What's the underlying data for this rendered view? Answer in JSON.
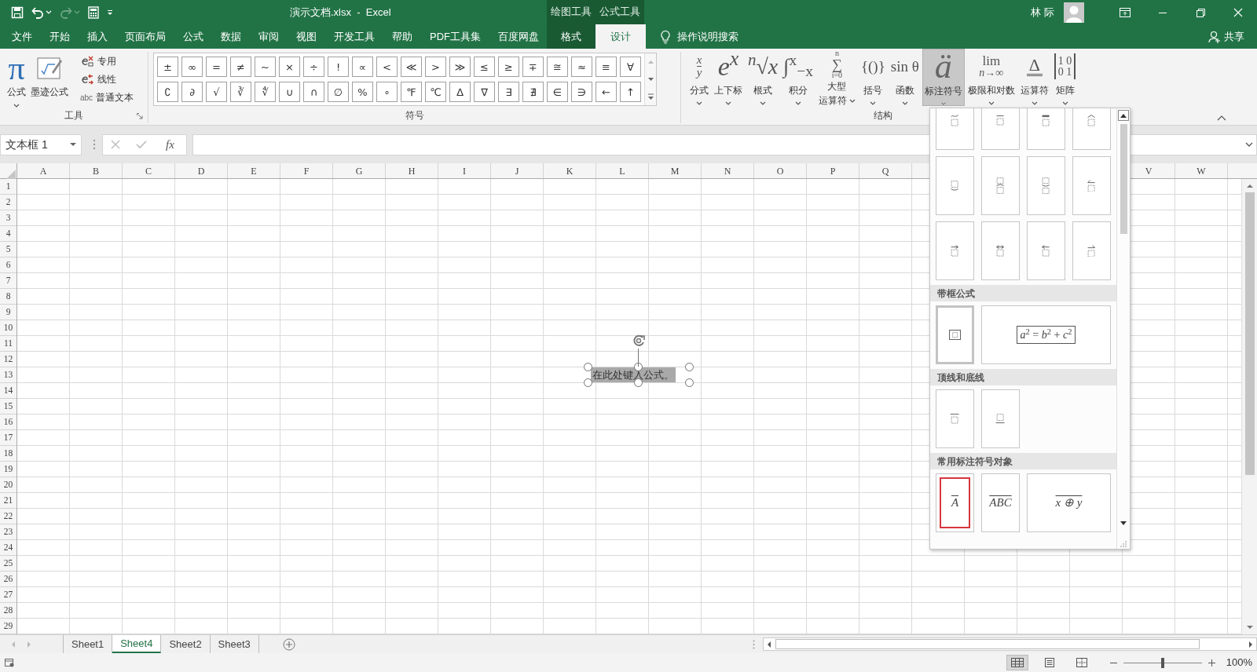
{
  "title_bar": {
    "quick_access": [
      {
        "kind": "save",
        "disabled": false
      },
      {
        "kind": "undo",
        "disabled": false
      },
      {
        "kind": "redo",
        "disabled": true
      },
      {
        "kind": "calculator",
        "disabled": false
      },
      {
        "kind": "customize",
        "disabled": false
      }
    ],
    "title": "演示文档.xlsx  -  Excel",
    "context_headers": [
      "绘图工具",
      "公式工具"
    ],
    "user": "林 际"
  },
  "ribbon_tabs": [
    {
      "label": "文件",
      "selected": false,
      "contextual": false
    },
    {
      "label": "开始",
      "selected": false,
      "contextual": false
    },
    {
      "label": "插入",
      "selected": false,
      "contextual": false
    },
    {
      "label": "页面布局",
      "selected": false,
      "contextual": false
    },
    {
      "label": "公式",
      "selected": false,
      "contextual": false
    },
    {
      "label": "数据",
      "selected": false,
      "contextual": false
    },
    {
      "label": "审阅",
      "selected": false,
      "contextual": false
    },
    {
      "label": "视图",
      "selected": false,
      "contextual": false
    },
    {
      "label": "开发工具",
      "selected": false,
      "contextual": false
    },
    {
      "label": "帮助",
      "selected": false,
      "contextual": false
    },
    {
      "label": "PDF工具集",
      "selected": false,
      "contextual": false
    },
    {
      "label": "百度网盘",
      "selected": false,
      "contextual": false
    },
    {
      "label": "格式",
      "selected": false,
      "contextual": true
    },
    {
      "label": "设计",
      "selected": true,
      "contextual": true
    }
  ],
  "tell_me": "操作说明搜索",
  "share": "共享",
  "tools_group": {
    "label": "工具",
    "big_buttons": [
      {
        "kind": "pi",
        "glyph": "π",
        "label": "公式",
        "dropdown": true
      },
      {
        "kind": "ink",
        "label": "墨迹公式",
        "dropdown": false
      }
    ],
    "small_buttons": [
      {
        "kind": "professional",
        "label": "专用"
      },
      {
        "kind": "linear",
        "label": "线性"
      },
      {
        "kind": "normal-text",
        "prefix": "abc",
        "label": "普通文本"
      }
    ]
  },
  "symbols_group": {
    "label": "符号",
    "rows": [
      [
        "±",
        "∞",
        "=",
        "≠",
        "~",
        "×",
        "÷",
        "!",
        "∝",
        "<",
        "≪",
        ">",
        "≫",
        "≤",
        "≥",
        "∓",
        "≅",
        "≈",
        "≡",
        "∀"
      ],
      [
        "∁",
        "∂",
        "√",
        "∛",
        "∜",
        "∪",
        "∩",
        "∅",
        "%",
        "∘",
        "℉",
        "℃",
        "∆",
        "∇",
        "∃",
        "∄",
        "∈",
        "∋",
        "←",
        "↑"
      ]
    ]
  },
  "structures_group": {
    "label": "结构",
    "items": [
      {
        "kind": "fraction",
        "glyph_lines": [
          "x",
          "y"
        ],
        "label": "分式",
        "selected": false
      },
      {
        "kind": "script",
        "glyph_lines": [
          "e$^{x}$"
        ],
        "label": "上下标",
        "selected": false
      },
      {
        "kind": "radical",
        "glyph_lines": [
          "$^{n}$√x"
        ],
        "label": "根式",
        "selected": false
      },
      {
        "kind": "integral",
        "glyph_lines": [
          "∫$^{x}$$_{−x}$"
        ],
        "label": "积分",
        "selected": false
      },
      {
        "kind": "sum",
        "glyph_lines": [
          "n",
          "∑",
          "i=0"
        ],
        "label": "大型",
        "label_2": "运算符",
        "selected": false
      },
      {
        "kind": "plain",
        "glyph_lines": [
          "{()}"
        ],
        "label": "括号",
        "selected": false
      },
      {
        "kind": "plain",
        "glyph_lines": [
          "sin θ"
        ],
        "label": "函数",
        "selected": false
      },
      {
        "kind": "accent",
        "glyph_lines": [
          "ä"
        ],
        "label": "标注符号",
        "selected": true
      },
      {
        "kind": "limit",
        "glyph_lines": [
          "lim",
          "n→∞"
        ],
        "label": "极限和对数",
        "selected": false
      },
      {
        "kind": "operator",
        "glyph_lines": [
          "Δ"
        ],
        "label": "运算符",
        "selected": false
      },
      {
        "kind": "matrix",
        "glyph_lines": [
          "1 0",
          "0 1"
        ],
        "label": "矩阵",
        "selected": false
      }
    ]
  },
  "formula_bar": {
    "name_box": "文本框 1",
    "fx": "fx"
  },
  "columns_left": [
    "A",
    "B",
    "C",
    "D",
    "E",
    "F",
    "G",
    "H",
    "I",
    "J",
    "K",
    "L",
    "M",
    "N",
    "O",
    "P",
    "Q"
  ],
  "columns_right": [
    "V",
    "W"
  ],
  "rows": [
    "1",
    "2",
    "3",
    "4",
    "5",
    "6",
    "7",
    "8",
    "9",
    "10",
    "11",
    "12",
    "13",
    "14",
    "15",
    "16",
    "17",
    "18",
    "19",
    "20",
    "21",
    "22",
    "23",
    "24",
    "25",
    "26",
    "27",
    "28",
    "29"
  ],
  "text_box": {
    "text": "在此处键入公式。",
    "selected": true
  },
  "sheet_tabs": [
    {
      "label": "Sheet1",
      "selected": false
    },
    {
      "label": "Sheet4",
      "selected": true
    },
    {
      "label": "Sheet2",
      "selected": false
    },
    {
      "label": "Sheet3",
      "selected": false
    }
  ],
  "status_bar": {
    "views": [
      {
        "kind": "normal",
        "selected": true
      },
      {
        "kind": "page-layout",
        "selected": false
      },
      {
        "kind": "page-break",
        "selected": false
      }
    ],
    "zoom_slider": {
      "level": 0.5
    },
    "zoom": "100%"
  },
  "gallery": {
    "sections": [
      {
        "tiles": [
          {
            "kind": "tilde-above",
            "selected": false,
            "highlighted": false
          },
          {
            "kind": "bar-above",
            "selected": false,
            "highlighted": false
          },
          {
            "kind": "thick-bar-above",
            "selected": false,
            "highlighted": false
          },
          {
            "kind": "hat-above",
            "selected": false,
            "highlighted": false
          },
          {
            "kind": "brace-below",
            "selected": false,
            "highlighted": false
          },
          {
            "kind": "brace-above-stacked",
            "selected": false,
            "highlighted": false
          },
          {
            "kind": "brace-between-stacked",
            "selected": false,
            "highlighted": false
          },
          {
            "kind": "harpoon-left-above",
            "selected": false,
            "highlighted": false
          },
          {
            "kind": "arrow-right-above",
            "selected": false,
            "highlighted": false
          },
          {
            "kind": "arrow-both-above",
            "selected": false,
            "highlighted": false
          },
          {
            "kind": "arrow-left-above",
            "selected": false,
            "highlighted": false
          },
          {
            "kind": "harpoon-right-above",
            "selected": false,
            "highlighted": false
          }
        ]
      },
      {
        "header": "带框公式",
        "tiles": [
          {
            "kind": "boxed",
            "selected": true,
            "highlighted": false
          },
          {
            "kind": "boxed-text",
            "text": "*a*$^{2}$ = *b*$^{2}$ + *c*$^{2}$",
            "selected": false,
            "highlighted": false
          }
        ]
      },
      {
        "header": "顶线和底线",
        "tiles": [
          {
            "kind": "overbar",
            "selected": false,
            "highlighted": false
          },
          {
            "kind": "underbar",
            "selected": false,
            "highlighted": false
          }
        ]
      },
      {
        "header": "常用标注符号对象",
        "tiles": [
          {
            "kind": "overline-text",
            "text": "A",
            "selected": false,
            "highlighted": true
          },
          {
            "kind": "overline-text",
            "text": "ABC",
            "selected": false,
            "highlighted": false
          },
          {
            "kind": "wide-overline-text",
            "text": "x ⊕ y",
            "selected": false,
            "highlighted": false
          }
        ]
      }
    ]
  }
}
